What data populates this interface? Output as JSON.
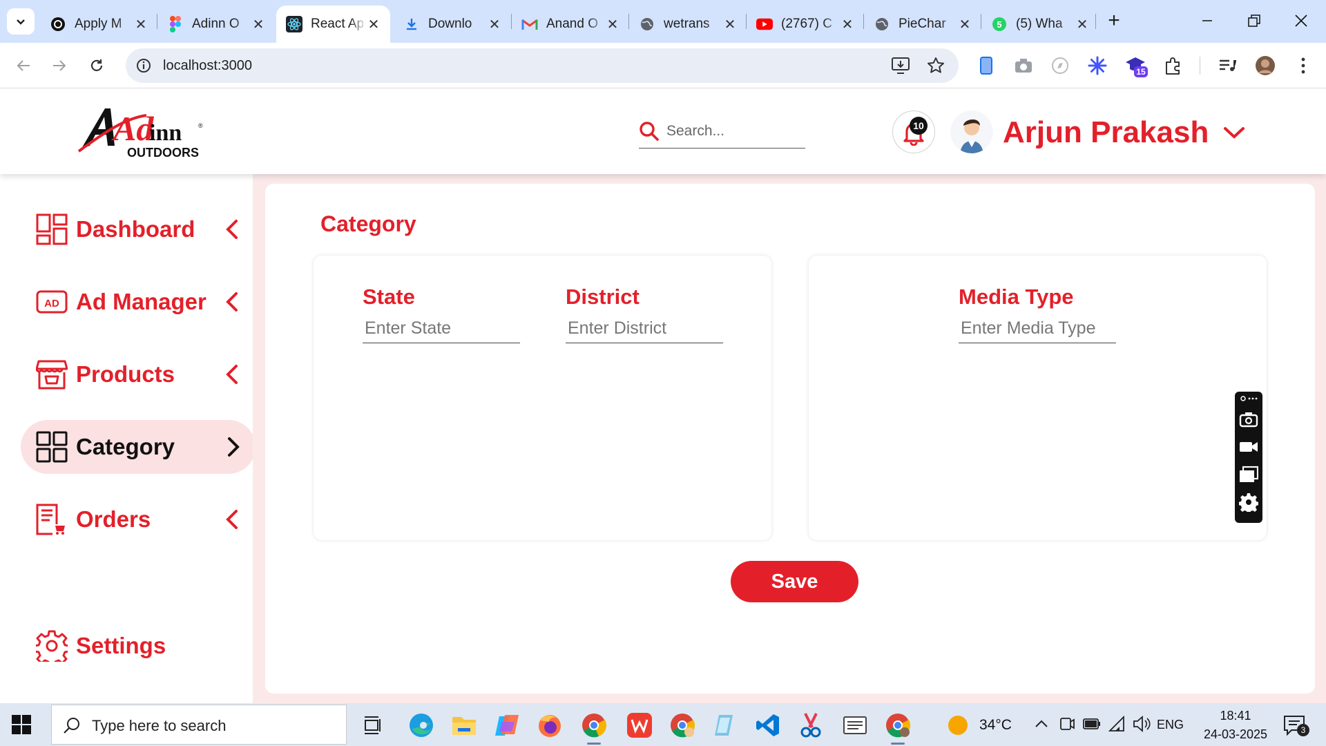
{
  "browser": {
    "tabs": [
      {
        "title": "Apply M",
        "icon": "openai-icon"
      },
      {
        "title": "Adinn O",
        "icon": "figma-icon"
      },
      {
        "title": "React Ap",
        "icon": "react-icon",
        "active": true
      },
      {
        "title": "Downlo",
        "icon": "download-icon"
      },
      {
        "title": "Anand O",
        "icon": "gmail-icon"
      },
      {
        "title": "wetrans",
        "icon": "globe-icon"
      },
      {
        "title": "(2767) C",
        "icon": "youtube-icon"
      },
      {
        "title": "PieChar",
        "icon": "globe-icon"
      },
      {
        "title": "(5) Wha",
        "icon": "whatsapp-icon"
      }
    ],
    "url": "localhost:3000",
    "extension_badge": "15"
  },
  "header": {
    "brand": {
      "line1": "Ad",
      "line2": "inn",
      "line3": "OUTDOORS"
    },
    "search_placeholder": "Search...",
    "notification_count": "10",
    "user_name": "Arjun Prakash"
  },
  "sidebar": {
    "items": [
      {
        "label": "Dashboard",
        "icon": "dashboard-grid-icon"
      },
      {
        "label": "Ad Manager",
        "icon": "ad-icon"
      },
      {
        "label": "Products",
        "icon": "store-icon"
      },
      {
        "label": "Category",
        "icon": "category-grid-icon",
        "active": true
      },
      {
        "label": "Orders",
        "icon": "orders-icon"
      }
    ],
    "settings_label": "Settings"
  },
  "main": {
    "title": "Category",
    "left_card": {
      "state_label": "State",
      "state_placeholder": "Enter State",
      "district_label": "District",
      "district_placeholder": "Enter District"
    },
    "right_card": {
      "media_type_label": "Media Type",
      "media_type_placeholder": "Enter Media Type"
    },
    "save_label": "Save"
  },
  "colors": {
    "brand_red": "#e3202a",
    "sidebar_bg": "#fbe9ea",
    "chrome_tabstrip": "#d3e3fd"
  },
  "taskbar": {
    "search_placeholder": "Type here to search",
    "weather": "34°C",
    "language": "ENG",
    "time": "18:41",
    "date": "24-03-2025",
    "notification_badge": "3"
  }
}
